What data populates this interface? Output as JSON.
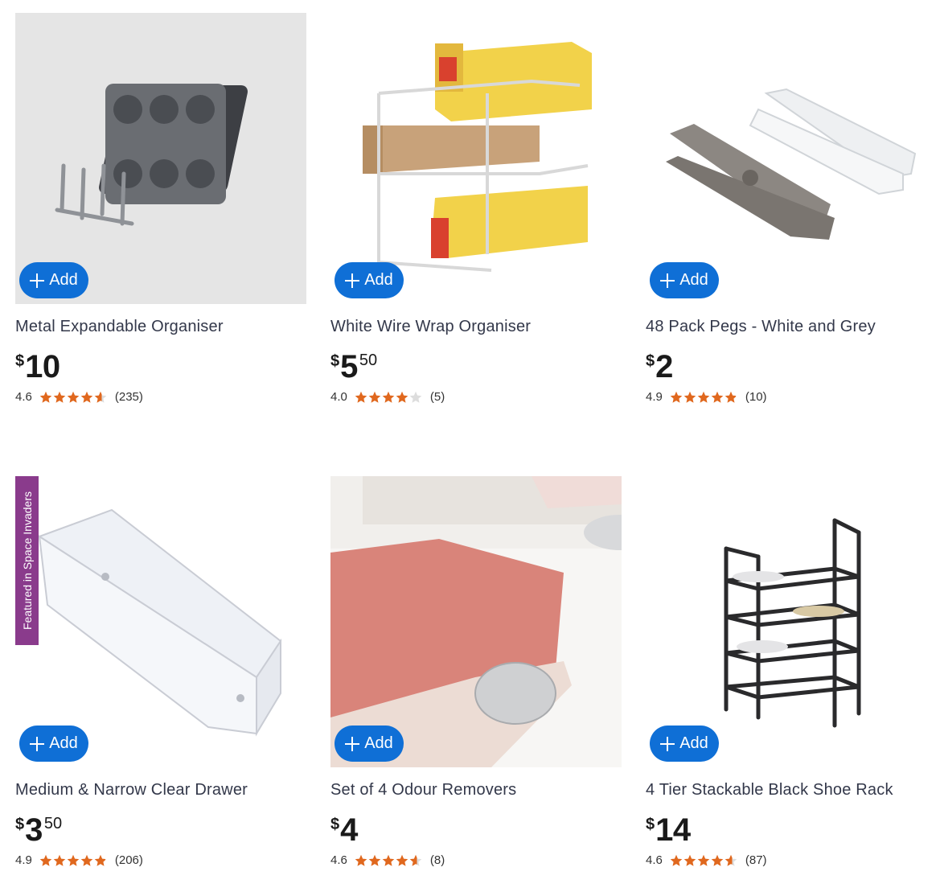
{
  "add_label": "Add",
  "colors": {
    "accent": "#0f6fd6",
    "star": "#e0681e",
    "star_empty": "#dddddd",
    "badge": "#8a3b8c"
  },
  "products": [
    {
      "name": "Metal Expandable Organiser",
      "currency": "$",
      "dollars": "10",
      "cents": "",
      "rating": "4.6",
      "rating_value": 4.6,
      "reviews": "(235)",
      "badge": ""
    },
    {
      "name": "White Wire Wrap Organiser",
      "currency": "$",
      "dollars": "5",
      "cents": "50",
      "rating": "4.0",
      "rating_value": 4.0,
      "reviews": "(5)",
      "badge": ""
    },
    {
      "name": "48 Pack Pegs - White and Grey",
      "currency": "$",
      "dollars": "2",
      "cents": "",
      "rating": "4.9",
      "rating_value": 4.9,
      "reviews": "(10)",
      "badge": ""
    },
    {
      "name": "Medium & Narrow Clear Drawer",
      "currency": "$",
      "dollars": "3",
      "cents": "50",
      "rating": "4.9",
      "rating_value": 4.9,
      "reviews": "(206)",
      "badge": "Featured in Space Invaders"
    },
    {
      "name": "Set of 4 Odour Removers",
      "currency": "$",
      "dollars": "4",
      "cents": "",
      "rating": "4.6",
      "rating_value": 4.6,
      "reviews": "(8)",
      "badge": ""
    },
    {
      "name": "4 Tier Stackable Black Shoe Rack",
      "currency": "$",
      "dollars": "14",
      "cents": "",
      "rating": "4.6",
      "rating_value": 4.6,
      "reviews": "(87)",
      "badge": ""
    }
  ]
}
